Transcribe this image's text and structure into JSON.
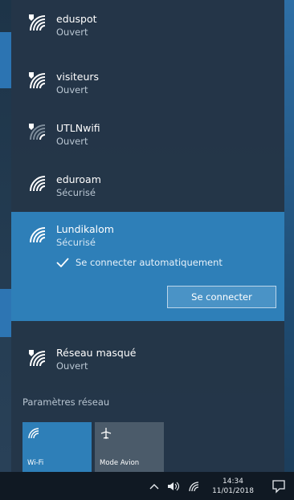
{
  "networks": [
    {
      "name": "eduspot",
      "status": "Ouvert",
      "secured": false
    },
    {
      "name": "visiteurs",
      "status": "Ouvert",
      "secured": false
    },
    {
      "name": "UTLNwifi",
      "status": "Ouvert",
      "secured": false
    },
    {
      "name": "eduroam",
      "status": "Sécurisé",
      "secured": true
    },
    {
      "name": "Lundikalom",
      "status": "Sécurisé",
      "secured": true,
      "selected": true
    },
    {
      "name": "Réseau masqué",
      "status": "Ouvert",
      "secured": false
    }
  ],
  "selected_network": {
    "auto_connect_label": "Se connecter automatiquement",
    "auto_connect_checked": true,
    "connect_button": "Se connecter"
  },
  "settings_link": "Paramètres réseau",
  "quick_actions": [
    {
      "label": "Wi-Fi",
      "icon": "wifi-icon",
      "active": true
    },
    {
      "label": "Mode Avion",
      "icon": "airplane-icon",
      "active": false
    }
  ],
  "taskbar": {
    "time": "14:34",
    "date": "11/01/2018"
  },
  "colors": {
    "accent": "#2e7fb8",
    "flyout_bg": "#243648",
    "taskbar_bg": "#101923"
  }
}
